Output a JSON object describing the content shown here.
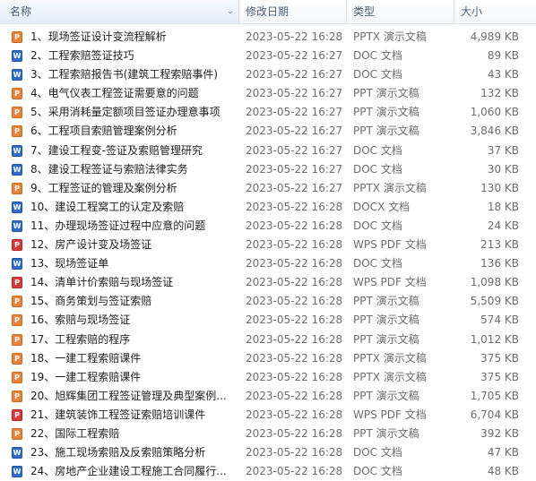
{
  "columns": {
    "name": "名称",
    "date": "修改日期",
    "type": "类型",
    "size": "大小"
  },
  "sort_icon": "chevron-up-icon",
  "files": [
    {
      "name": "1、现场签证设计变流程解析",
      "date": "2023-05-22 16:28",
      "type": "PPTX 演示文稿",
      "size": "4,989 KB",
      "icon": "ppt"
    },
    {
      "name": "2、工程索赔签证技巧",
      "date": "2023-05-22 16:27",
      "type": "DOC 文档",
      "size": "89 KB",
      "icon": "doc"
    },
    {
      "name": "3、工程索赔报告书(建筑工程索赔事件)",
      "date": "2023-05-22 16:27",
      "type": "DOC 文档",
      "size": "43 KB",
      "icon": "doc"
    },
    {
      "name": "4、电气仪表工程签证需要意的问题",
      "date": "2023-05-22 16:27",
      "type": "PPT 演示文稿",
      "size": "132 KB",
      "icon": "ppt"
    },
    {
      "name": "5、采用消耗量定额项目签证办理意事项",
      "date": "2023-05-22 16:27",
      "type": "PPT 演示文稿",
      "size": "1,060 KB",
      "icon": "ppt"
    },
    {
      "name": "6、工程项目索赔管理案例分析",
      "date": "2023-05-22 16:27",
      "type": "PPT 演示文稿",
      "size": "3,846 KB",
      "icon": "ppt"
    },
    {
      "name": "7、建设工程变-签证及索赔管理研究",
      "date": "2023-05-22 16:27",
      "type": "DOC 文档",
      "size": "37 KB",
      "icon": "doc"
    },
    {
      "name": "8、建设工程签证与索赔法律实务",
      "date": "2023-05-22 16:27",
      "type": "DOC 文档",
      "size": "30 KB",
      "icon": "doc"
    },
    {
      "name": "9、工程签证的管理及案例分析",
      "date": "2023-05-22 16:27",
      "type": "PPTX 演示文稿",
      "size": "130 KB",
      "icon": "ppt"
    },
    {
      "name": "10、建设工程窝工的认定及索赔",
      "date": "2023-05-22 16:28",
      "type": "DOCX 文档",
      "size": "18 KB",
      "icon": "doc"
    },
    {
      "name": "11、办理现场签证过程中应意的问题",
      "date": "2023-05-22 16:28",
      "type": "DOC 文档",
      "size": "24 KB",
      "icon": "doc"
    },
    {
      "name": "12、房产设计变及场签证",
      "date": "2023-05-22 16:28",
      "type": "WPS PDF 文档",
      "size": "213 KB",
      "icon": "pdf"
    },
    {
      "name": "13、现场签证单",
      "date": "2023-05-22 16:28",
      "type": "DOC 文档",
      "size": "136 KB",
      "icon": "doc"
    },
    {
      "name": "14、清单计价索赔与现场签证",
      "date": "2023-05-22 16:28",
      "type": "WPS PDF 文档",
      "size": "1,098 KB",
      "icon": "pdf"
    },
    {
      "name": "15、商务策划与签证索赔",
      "date": "2023-05-22 16:28",
      "type": "PPT 演示文稿",
      "size": "5,509 KB",
      "icon": "ppt"
    },
    {
      "name": "16、索赔与现场签证",
      "date": "2023-05-22 16:28",
      "type": "PPT 演示文稿",
      "size": "574 KB",
      "icon": "ppt"
    },
    {
      "name": "17、工程索赔的程序",
      "date": "2023-05-22 16:28",
      "type": "PPT 演示文稿",
      "size": "1,012 KB",
      "icon": "ppt"
    },
    {
      "name": "18、一建工程索赔课件",
      "date": "2023-05-22 16:28",
      "type": "PPTX 演示文稿",
      "size": "375 KB",
      "icon": "ppt"
    },
    {
      "name": "19、一建工程索赔课件",
      "date": "2023-05-22 16:28",
      "type": "PPTX 演示文稿",
      "size": "375 KB",
      "icon": "ppt"
    },
    {
      "name": "20、旭辉集团工程签证管理及典型案例...",
      "date": "2023-05-22 16:28",
      "type": "PPT 演示文稿",
      "size": "1,705 KB",
      "icon": "ppt"
    },
    {
      "name": "21、建筑装饰工程签证索赔培训课件",
      "date": "2023-05-22 16:28",
      "type": "WPS PDF 文档",
      "size": "6,704 KB",
      "icon": "pdf"
    },
    {
      "name": "22、国际工程索赔",
      "date": "2023-05-22 16:28",
      "type": "PPT 演示文稿",
      "size": "392 KB",
      "icon": "ppt"
    },
    {
      "name": "23、施工现场索赔及反索赔策略分析",
      "date": "2023-05-22 16:28",
      "type": "DOC 文档",
      "size": "47 KB",
      "icon": "doc"
    },
    {
      "name": "24、房地产企业建设工程施工合同履行...",
      "date": "2023-05-22 16:28",
      "type": "DOC 文档",
      "size": "48 KB",
      "icon": "doc"
    }
  ]
}
